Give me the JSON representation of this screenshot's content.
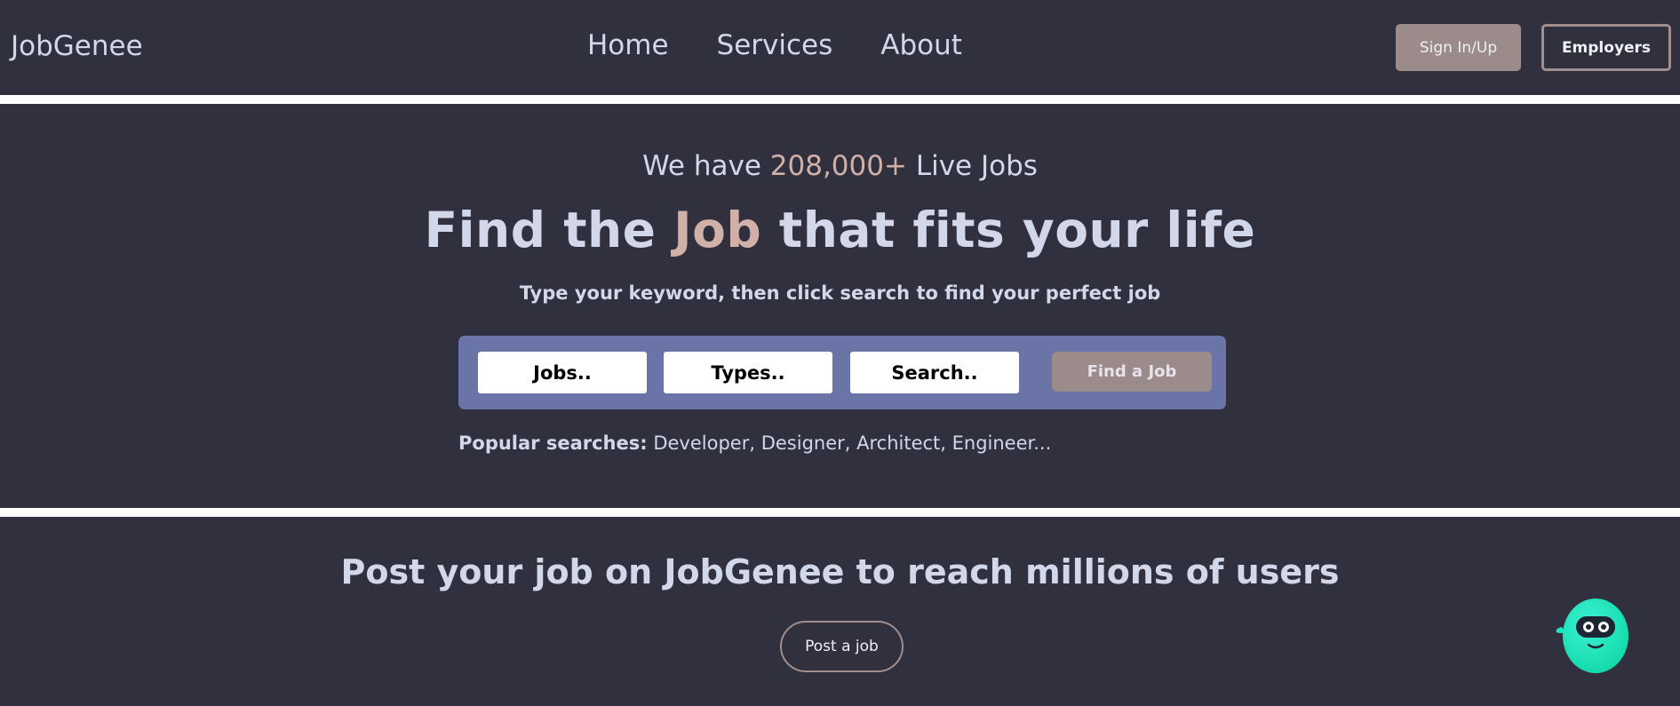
{
  "nav": {
    "brand": "JobGenee",
    "links": [
      "Home",
      "Services",
      "About"
    ],
    "signin_label": "Sign In/Up",
    "employers_label": "Employers"
  },
  "hero": {
    "live_prefix": "We have",
    "live_count": "208,000+",
    "live_suffix": "Live Jobs",
    "title_prefix": "Find the",
    "title_accent": "Job",
    "title_suffix": "that fits your life",
    "hint": "Type your keyword, then click search to find your perfect job"
  },
  "search": {
    "fields": [
      "Jobs..",
      "Types..",
      "Search.."
    ],
    "find_label": "Find a Job"
  },
  "popular": {
    "label": "Popular searches:",
    "items": "Developer, Designer, Architect, Engineer..."
  },
  "post": {
    "title": "Post your job on JobGenee to reach millions of users",
    "button_label": "Post a job"
  },
  "colors": {
    "background": "#31303e",
    "text": "#d2d8ea",
    "accent": "#d1b0a8",
    "button": "#9c8b8b",
    "search_panel": "#6b74a6",
    "chatbot": "#19e6c1"
  },
  "icons": {
    "chatbot": "chatbot-mascot-icon"
  }
}
